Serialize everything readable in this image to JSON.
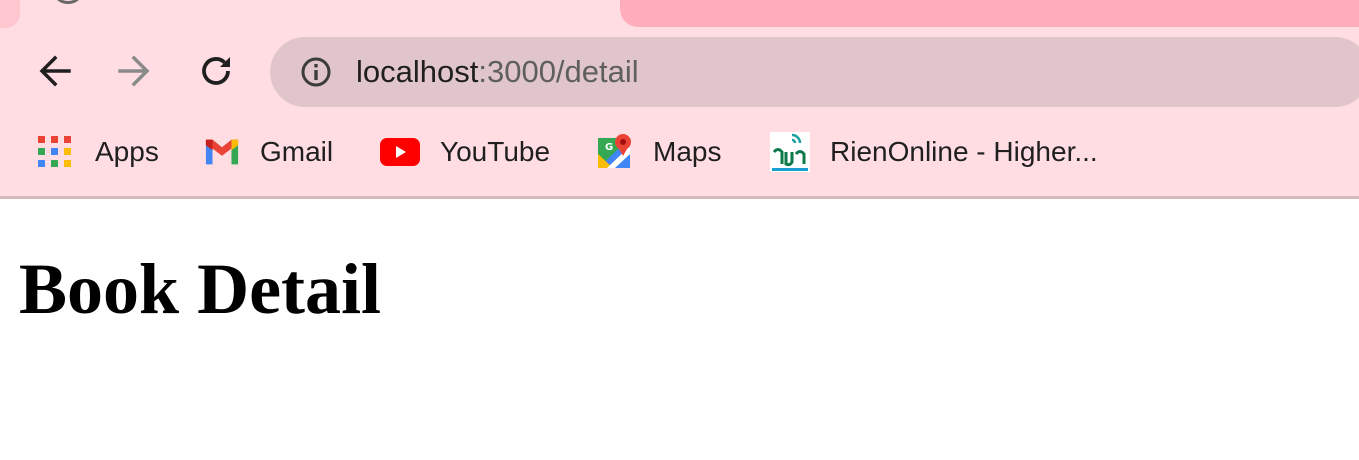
{
  "browser": {
    "nav": {
      "back_icon": "arrow-left-icon",
      "forward_icon": "arrow-right-icon",
      "reload_icon": "reload-icon"
    },
    "omnibox": {
      "icon": "info-icon",
      "host": "localhost",
      "path": ":3000/detail"
    },
    "bookmarks": [
      {
        "label": "Apps",
        "icon": "apps-grid-icon"
      },
      {
        "label": "Gmail",
        "icon": "gmail-icon"
      },
      {
        "label": "YouTube",
        "icon": "youtube-icon"
      },
      {
        "label": "Maps",
        "icon": "maps-icon"
      },
      {
        "label": "RienOnline - Higher...",
        "icon": "rienonline-icon"
      }
    ]
  },
  "page": {
    "title": "Book Detail"
  },
  "colors": {
    "chrome_bg": "#ffdde3",
    "omnibox_bg": "#e0c6ca",
    "inactive_tab": "#ffadbc",
    "youtube_red": "#ff0000"
  }
}
